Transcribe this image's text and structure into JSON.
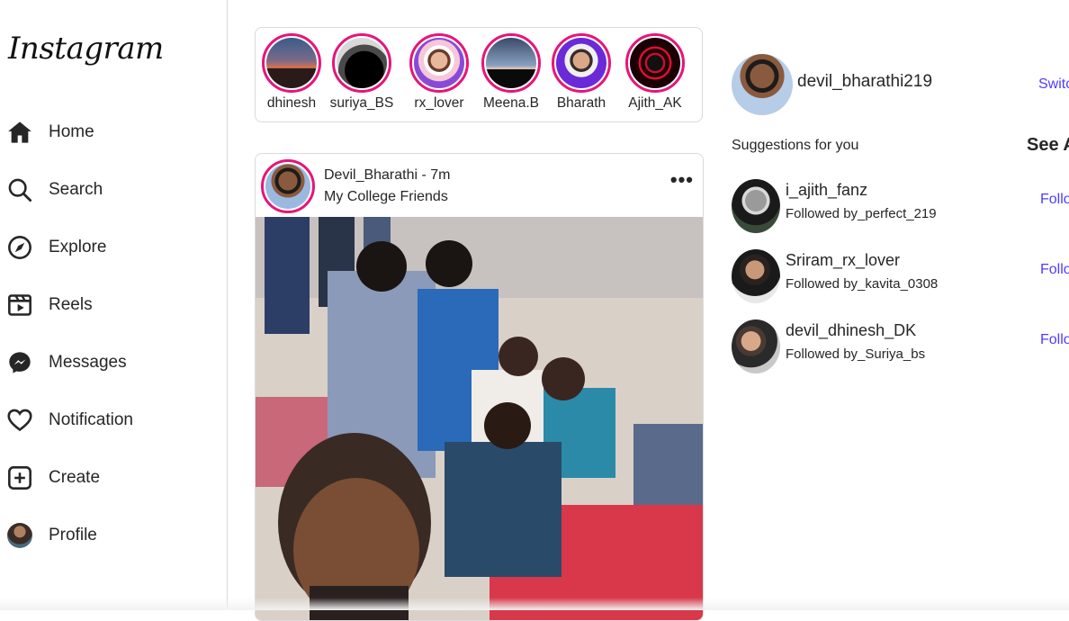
{
  "app": {
    "logo_text": "Instagram"
  },
  "sidebar": {
    "items": [
      {
        "label": "Home",
        "icon": "home-icon"
      },
      {
        "label": "Search",
        "icon": "search-icon"
      },
      {
        "label": "Explore",
        "icon": "compass-icon"
      },
      {
        "label": "Reels",
        "icon": "reels-icon"
      },
      {
        "label": "Messages",
        "icon": "messenger-icon"
      },
      {
        "label": "Notification",
        "icon": "heart-icon"
      },
      {
        "label": "Create",
        "icon": "plus-square-icon"
      },
      {
        "label": "Profile",
        "icon": "avatar"
      }
    ]
  },
  "stories": [
    {
      "name": "dhinesh"
    },
    {
      "name": "suriya_BS"
    },
    {
      "name": "rx_lover"
    },
    {
      "name": "Meena.B"
    },
    {
      "name": "Bharath"
    },
    {
      "name": "Ajith_AK"
    }
  ],
  "post": {
    "header": "Devil_Bharathi - 7m",
    "caption": "My College Friends",
    "more_icon": "more-horizontal-icon"
  },
  "profile": {
    "username": "devil_bharathi219",
    "switch_label": "Switch"
  },
  "suggestions": {
    "title": "Suggestions for you",
    "see_all": "See All",
    "items": [
      {
        "username": "i_ajith_fanz",
        "followed_by": "Followed by_perfect_219",
        "action": "Follow"
      },
      {
        "username": "Sriram_rx_lover",
        "followed_by": "Followed by_kavita_0308",
        "action": "Follow"
      },
      {
        "username": "devil_dhinesh_DK",
        "followed_by": "Followed by_Suriya_bs",
        "action": "Follow"
      }
    ]
  },
  "colors": {
    "story_ring": "#e4167b",
    "link": "#4f3bff",
    "border": "#dbdbdb"
  }
}
